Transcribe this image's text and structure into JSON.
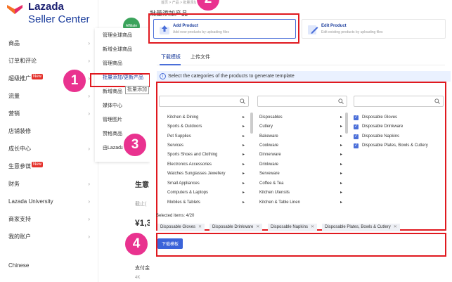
{
  "logo": {
    "brand": "Lazada",
    "sub": "Seller Center"
  },
  "sidebar": {
    "items": [
      {
        "label": "商品"
      },
      {
        "label": "订单和评论"
      },
      {
        "label": "超级推广",
        "badge": "New"
      },
      {
        "label": "流量"
      },
      {
        "label": "营销"
      },
      {
        "label": "店铺装修"
      },
      {
        "label": "成长中心"
      },
      {
        "label": "生意参谋",
        "badge": "New"
      },
      {
        "label": "财务"
      },
      {
        "label": "Lazada University"
      },
      {
        "label": "商家支持"
      },
      {
        "label": "我的账户"
      }
    ],
    "language": "Chinese"
  },
  "submenu": {
    "items": [
      "管理全球商品",
      "新增全球商品",
      "管理商品",
      "批量添加/更新产品",
      "新增商品",
      "媒体中心",
      "管理图片",
      "赞格商品",
      "由Lazada"
    ],
    "tooltip": "批量添加"
  },
  "dashboard": {
    "avatar": "Affiliate",
    "title": "生意",
    "sub": "截止(",
    "num": "¥1,3",
    "pay": "支付金额",
    "kpi": "4K"
  },
  "page": {
    "breadcrumb": "首页 > 产品 > 批量添加产品",
    "title": "批量添加产品",
    "modes": {
      "add": {
        "title": "Add Product",
        "desc": "Add new products by uploading files"
      },
      "edit": {
        "title": "Edit Product",
        "desc": "Edit existing products by uploading files"
      }
    },
    "tabs": [
      "下载模板",
      "上传文件"
    ],
    "info": "Select the categories of the products to generate template",
    "col1": [
      "Kitchen & Dining",
      "Sports & Outdoors",
      "Pet Supplies",
      "Services",
      "Sports Shoes and Clothing",
      "Electronics Accessories",
      "Watches Sunglasses Jewellery",
      "Small Appliances",
      "Computers & Laptops",
      "Mobiles & Tablets"
    ],
    "col2": [
      "Disposables",
      "Cutlery",
      "Bakeware",
      "Cookware",
      "Dinnerware",
      "Drinkware",
      "Serveware",
      "Coffee & Tea",
      "Kitchen Utensils",
      "Kitchen & Table Linen"
    ],
    "col3": [
      "Disposable Gloves",
      "Disposable Drinkware",
      "Disposable Napkins",
      "Disposable Plates, Bowls & Cutlery"
    ],
    "selected_label": "Selected items: 4/20",
    "tags": [
      "Disposable Gloves",
      "Disposable Drinkware",
      "Disposable Napkins",
      "Disposable Plates, Bowls & Cutlery"
    ],
    "download_btn": "下载模板"
  },
  "steps": [
    "1",
    "2",
    "3",
    "4"
  ],
  "colors": {
    "accent": "#4b6fd9",
    "highlight": "#e0191f",
    "step": "#e9328f"
  }
}
